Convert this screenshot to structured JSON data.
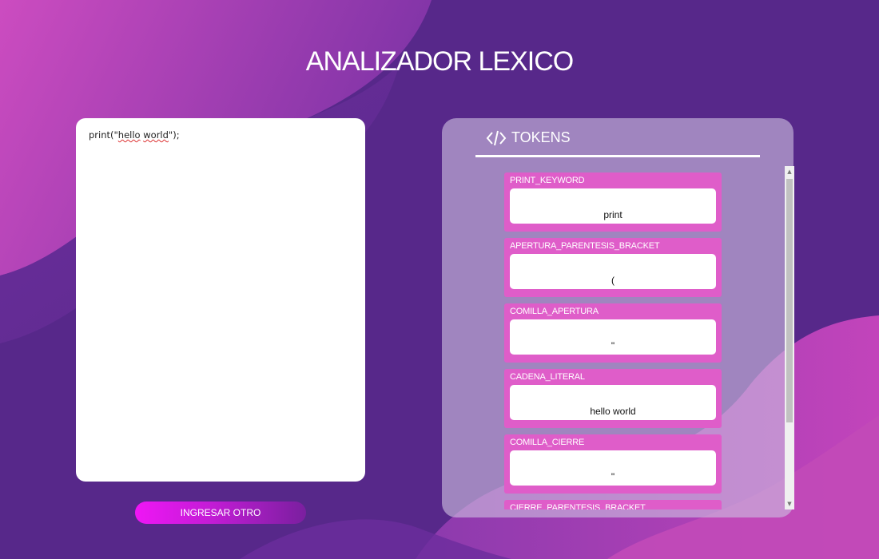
{
  "page": {
    "title": "ANALIZADOR LEXICO"
  },
  "editor": {
    "line_before": "print(\"",
    "word1": "hello",
    "space": " ",
    "word2": "world",
    "line_after": "\");"
  },
  "actions": {
    "ingresar_label": "INGRESAR OTRO"
  },
  "tokens": {
    "header": "TOKENS",
    "items": [
      {
        "name": "PRINT_KEYWORD",
        "value": "print"
      },
      {
        "name": "APERTURA_PARENTESIS_BRACKET",
        "value": "("
      },
      {
        "name": "COMILLA_APERTURA",
        "value": "\""
      },
      {
        "name": "CADENA_LITERAL",
        "value": "hello world"
      },
      {
        "name": "COMILLA_CIERRE",
        "value": "\""
      },
      {
        "name": "CIERRE_PARENTESIS_BRACKET",
        "value": ")"
      }
    ]
  },
  "colors": {
    "background": "#57288a",
    "accent_pink": "#df5dc9",
    "button_start": "#ef16f5",
    "button_end": "#7a1f9f"
  },
  "icons": {
    "tokens_header": "code-icon"
  }
}
